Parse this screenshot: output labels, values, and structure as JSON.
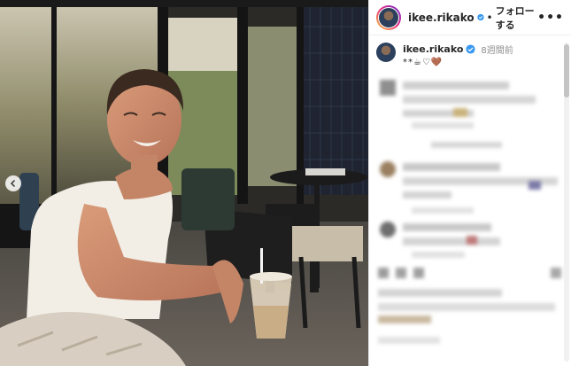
{
  "header": {
    "username": "ikee.rikako",
    "separator": "•",
    "follow_label": "フォローする",
    "more_label": "•••"
  },
  "caption": {
    "username": "ikee.rikako",
    "time_ago": "8週間前",
    "text": "**☕♡🤎"
  },
  "colors": {
    "verified": "#3897f0",
    "text": "#262626",
    "muted": "#8e8e8e"
  }
}
